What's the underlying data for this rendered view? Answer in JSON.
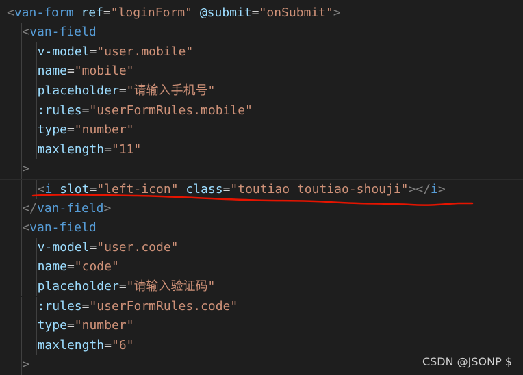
{
  "editor": {
    "lines": [
      [
        {
          "c": "t-punc",
          "t": "<"
        },
        {
          "c": "t-tag",
          "t": "van-form"
        },
        {
          "c": "t-plain",
          "t": " "
        },
        {
          "c": "t-attr",
          "t": "ref"
        },
        {
          "c": "t-plain",
          "t": "="
        },
        {
          "c": "t-str",
          "t": "\"loginForm\""
        },
        {
          "c": "t-plain",
          "t": " "
        },
        {
          "c": "t-attr",
          "t": "@submit"
        },
        {
          "c": "t-plain",
          "t": "="
        },
        {
          "c": "t-str",
          "t": "\"onSubmit\""
        },
        {
          "c": "t-punc",
          "t": ">"
        }
      ],
      [
        {
          "c": "t-punc",
          "t": "<"
        },
        {
          "c": "t-tag",
          "t": "van-field"
        }
      ],
      [
        {
          "c": "t-attr",
          "t": "v-model"
        },
        {
          "c": "t-plain",
          "t": "="
        },
        {
          "c": "t-str",
          "t": "\"user.mobile\""
        }
      ],
      [
        {
          "c": "t-attr",
          "t": "name"
        },
        {
          "c": "t-plain",
          "t": "="
        },
        {
          "c": "t-str",
          "t": "\"mobile\""
        }
      ],
      [
        {
          "c": "t-attr",
          "t": "placeholder"
        },
        {
          "c": "t-plain",
          "t": "="
        },
        {
          "c": "t-str",
          "t": "\"请输入手机号\""
        }
      ],
      [
        {
          "c": "t-attr",
          "t": ":rules"
        },
        {
          "c": "t-plain",
          "t": "="
        },
        {
          "c": "t-str",
          "t": "\"userFormRules.mobile\""
        }
      ],
      [
        {
          "c": "t-attr",
          "t": "type"
        },
        {
          "c": "t-plain",
          "t": "="
        },
        {
          "c": "t-str",
          "t": "\"number\""
        }
      ],
      [
        {
          "c": "t-attr",
          "t": "maxlength"
        },
        {
          "c": "t-plain",
          "t": "="
        },
        {
          "c": "t-str",
          "t": "\"11\""
        }
      ],
      [
        {
          "c": "t-punc",
          "t": ">"
        }
      ],
      [
        {
          "c": "t-punc",
          "t": "<"
        },
        {
          "c": "t-tag",
          "t": "i"
        },
        {
          "c": "t-plain",
          "t": " "
        },
        {
          "c": "t-attr",
          "t": "slot"
        },
        {
          "c": "t-plain",
          "t": "="
        },
        {
          "c": "t-str",
          "t": "\"left-icon\""
        },
        {
          "c": "t-plain",
          "t": " "
        },
        {
          "c": "t-attr",
          "t": "class"
        },
        {
          "c": "t-plain",
          "t": "="
        },
        {
          "c": "t-str",
          "t": "\"toutiao toutiao-shouji\""
        },
        {
          "c": "t-punc",
          "t": "></"
        },
        {
          "c": "t-tag",
          "t": "i"
        },
        {
          "c": "t-punc",
          "t": ">"
        }
      ],
      [
        {
          "c": "t-punc",
          "t": "</"
        },
        {
          "c": "t-tag",
          "t": "van-field"
        },
        {
          "c": "t-punc",
          "t": ">"
        }
      ],
      [
        {
          "c": "t-punc",
          "t": "<"
        },
        {
          "c": "t-tag",
          "t": "van-field"
        }
      ],
      [
        {
          "c": "t-attr",
          "t": "v-model"
        },
        {
          "c": "t-plain",
          "t": "="
        },
        {
          "c": "t-str",
          "t": "\"user.code\""
        }
      ],
      [
        {
          "c": "t-attr",
          "t": "name"
        },
        {
          "c": "t-plain",
          "t": "="
        },
        {
          "c": "t-str",
          "t": "\"code\""
        }
      ],
      [
        {
          "c": "t-attr",
          "t": "placeholder"
        },
        {
          "c": "t-plain",
          "t": "="
        },
        {
          "c": "t-str",
          "t": "\"请输入验证码\""
        }
      ],
      [
        {
          "c": "t-attr",
          "t": ":rules"
        },
        {
          "c": "t-plain",
          "t": "="
        },
        {
          "c": "t-str",
          "t": "\"userFormRules.code\""
        }
      ],
      [
        {
          "c": "t-attr",
          "t": "type"
        },
        {
          "c": "t-plain",
          "t": "="
        },
        {
          "c": "t-str",
          "t": "\"number\""
        }
      ],
      [
        {
          "c": "t-attr",
          "t": "maxlength"
        },
        {
          "c": "t-plain",
          "t": "="
        },
        {
          "c": "t-str",
          "t": "\"6\""
        }
      ],
      [
        {
          "c": "t-punc",
          "t": ">"
        }
      ]
    ],
    "indent_levels": [
      0,
      1,
      2,
      2,
      2,
      2,
      2,
      2,
      1,
      2,
      1,
      1,
      2,
      2,
      2,
      2,
      2,
      2,
      1
    ],
    "current_line": 10,
    "colors": {
      "background": "#1e1e1e",
      "tag": "#569cd6",
      "attribute": "#9cdcfe",
      "string": "#ce9178",
      "punctuation": "#808080",
      "annotation": "#e51400"
    }
  },
  "watermark": "CSDN @JSONP $"
}
